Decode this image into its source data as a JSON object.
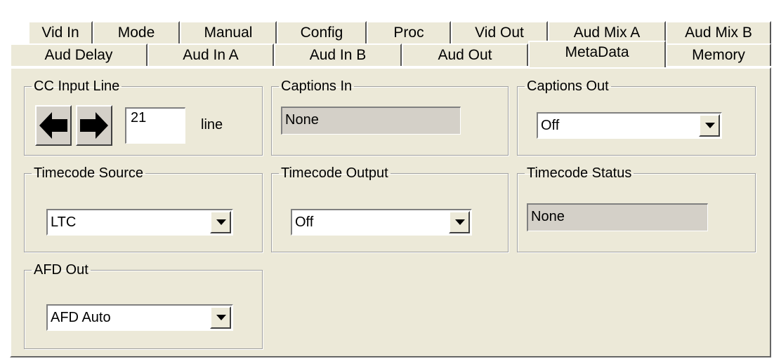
{
  "tabs_row1": [
    "Vid In",
    "Mode",
    "Manual",
    "Config",
    "Proc",
    "Vid Out",
    "Aud Mix A",
    "Aud Mix B"
  ],
  "tabs_row2": [
    "Aud Delay",
    "Aud In A",
    "Aud In B",
    "Aud Out",
    "MetaData",
    "Memory"
  ],
  "active_tab": "MetaData",
  "cc_input_line": {
    "legend": "CC Input Line",
    "value": "21",
    "unit": "line",
    "left_icon": "arrow-left-icon",
    "right_icon": "arrow-right-icon"
  },
  "captions_in": {
    "legend": "Captions In",
    "value": "None"
  },
  "captions_out": {
    "legend": "Captions Out",
    "value": "Off"
  },
  "timecode_source": {
    "legend": "Timecode Source",
    "value": "LTC"
  },
  "timecode_output": {
    "legend": "Timecode Output",
    "value": "Off"
  },
  "timecode_status": {
    "legend": "Timecode Status",
    "value": "None"
  },
  "afd_out": {
    "legend": "AFD Out",
    "value": "AFD Auto"
  }
}
